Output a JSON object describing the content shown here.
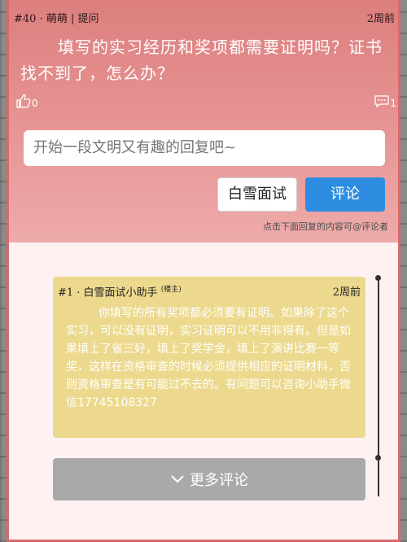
{
  "post": {
    "meta": "#40 · 萌萌 | 提问",
    "time": "2周前",
    "question": "填写的实习经历和奖项都需要证明吗？证书找不到了，怎么办？",
    "likes": "0",
    "comments": "1"
  },
  "composer": {
    "placeholder": "开始一段文明又有趣的回复吧~",
    "name_label": "白雪面试",
    "submit_label": "评论",
    "hint": "点击下面回复的内容可@评论者"
  },
  "replies": [
    {
      "header": "#1 · 白雪面试小助手",
      "badge": "(楼主)",
      "time": "2周前",
      "body": "你填写的所有奖项都必须要有证明。如果除了这个实习，可以没有证明，实习证明可以不用非得有。但是如果填上了省三好，填上了奖学金，填上了演讲比赛一等奖，这样在资格审查的时候必须提供相应的证明材料，否则资格审查是有可能过不去的。有问题可以咨询小助手微信17745108327"
    }
  ],
  "more": {
    "label": "更多评论"
  },
  "colors": {
    "accent": "#2e8de0",
    "header_bg": "#dc7e7e",
    "reply_bg": "#ecd98e"
  }
}
